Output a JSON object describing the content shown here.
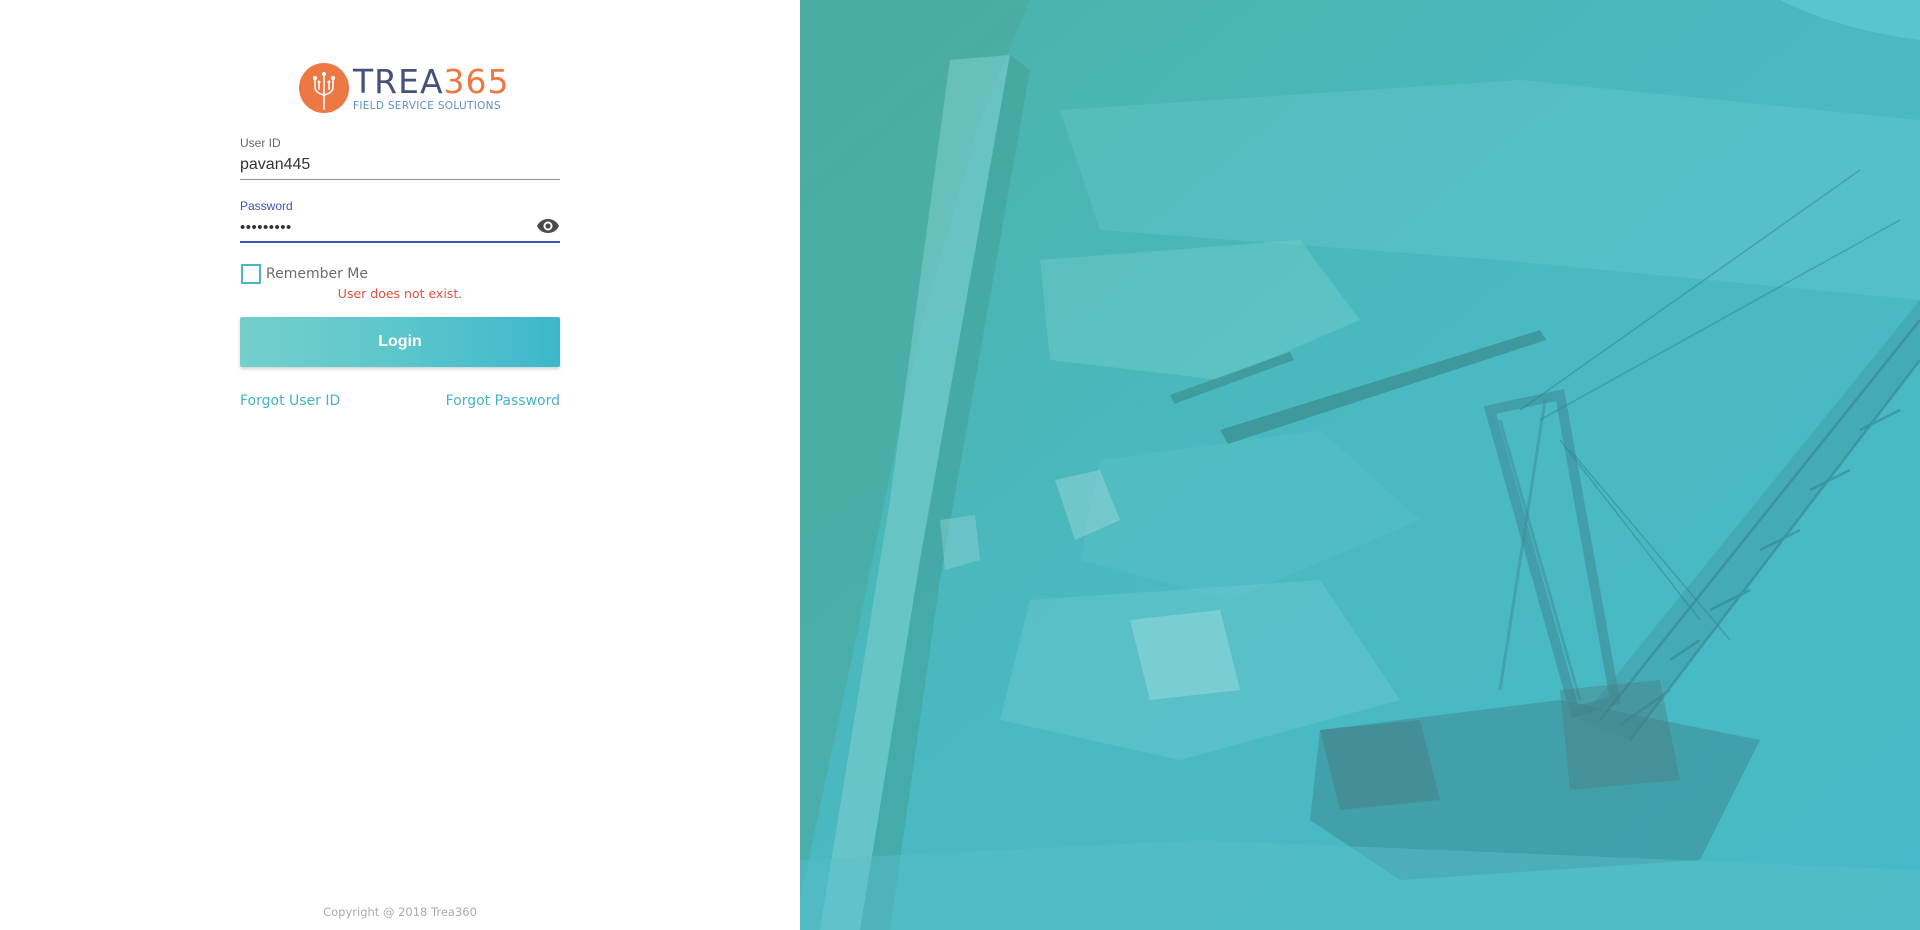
{
  "logo": {
    "title_part1": "TREA",
    "title_part2": "365",
    "subtitle": "FIELD SERVICE SOLUTIONS"
  },
  "form": {
    "user_id": {
      "label": "User ID",
      "value": "pavan445"
    },
    "password": {
      "label": "Password",
      "value": "•••••••••"
    },
    "remember_me_label": "Remember Me",
    "remember_me_checked": false,
    "error_message": "User does not exist.",
    "login_label": "Login",
    "forgot_user_id": "Forgot User ID",
    "forgot_password": "Forgot Password"
  },
  "footer": {
    "copyright": "Copyright @ 2018 Trea360"
  },
  "colors": {
    "accent": "#44b4c4",
    "brand_orange": "#ee7843",
    "brand_navy": "#44517a",
    "focus": "#3f51b5",
    "error": "#e0533e"
  },
  "icons": {
    "logo": "trident-circuit-icon",
    "password_toggle": "eye-icon"
  }
}
